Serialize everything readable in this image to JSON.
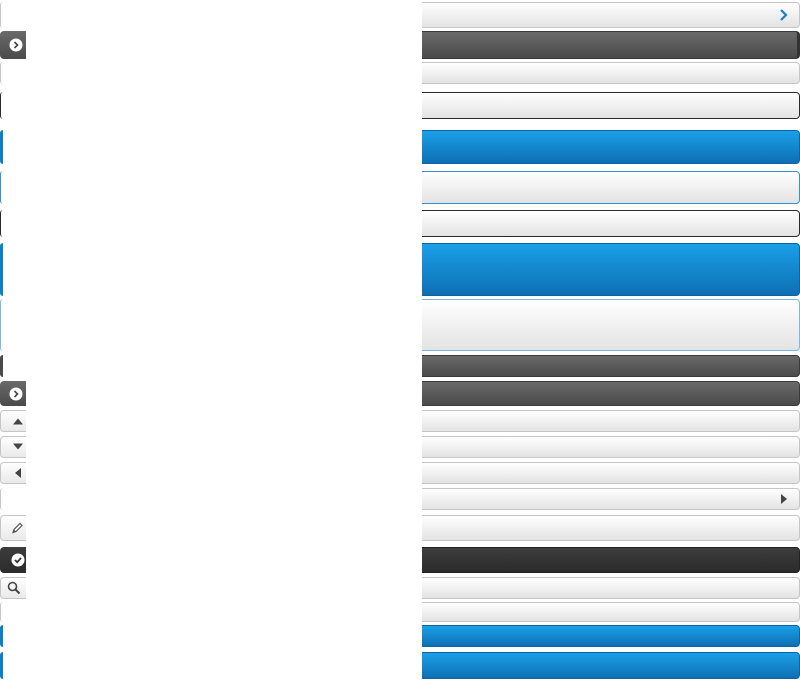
{
  "buttons": [
    {
      "id": "row1",
      "style": "light",
      "icon": "chevron-right-icon",
      "icon_color": "#1a7fcf",
      "label": ""
    },
    {
      "id": "row2",
      "style": "dark",
      "icon": "play-circle-icon",
      "label": ""
    },
    {
      "id": "row3",
      "style": "light",
      "label": ""
    },
    {
      "id": "row4",
      "style": "light-dark-border",
      "label": ""
    },
    {
      "id": "row5",
      "style": "blue",
      "label": ""
    },
    {
      "id": "row6",
      "style": "light-blue-border",
      "label": ""
    },
    {
      "id": "row7",
      "style": "light-dark-border",
      "label": ""
    },
    {
      "id": "row8",
      "style": "blue-large",
      "label": ""
    },
    {
      "id": "row9",
      "style": "light-large",
      "label": ""
    },
    {
      "id": "row10",
      "style": "dark-thin",
      "label": ""
    },
    {
      "id": "row11",
      "style": "dark",
      "icon": "play-circle-icon",
      "label": ""
    },
    {
      "id": "row12",
      "style": "light",
      "icon": "arrow-up-icon",
      "label": ""
    },
    {
      "id": "row13",
      "style": "light",
      "icon": "arrow-down-icon",
      "label": ""
    },
    {
      "id": "row14",
      "style": "light",
      "icon": "arrow-left-icon",
      "label": ""
    },
    {
      "id": "row15",
      "style": "light",
      "icon": "arrow-right-icon",
      "label": ""
    },
    {
      "id": "row16",
      "style": "light",
      "icon": "pencil-icon",
      "label": ""
    },
    {
      "id": "row17",
      "style": "darker",
      "icon": "check-circle-icon",
      "label": ""
    },
    {
      "id": "row18",
      "style": "light",
      "icon": "search-icon",
      "label": ""
    },
    {
      "id": "row19",
      "style": "light",
      "label": ""
    },
    {
      "id": "row20",
      "style": "blue",
      "label": ""
    },
    {
      "id": "row21",
      "style": "blue",
      "label": ""
    }
  ],
  "colors": {
    "accent_blue": "#1488d4",
    "dark_bar": "#555555",
    "light_bar": "#efefef"
  }
}
